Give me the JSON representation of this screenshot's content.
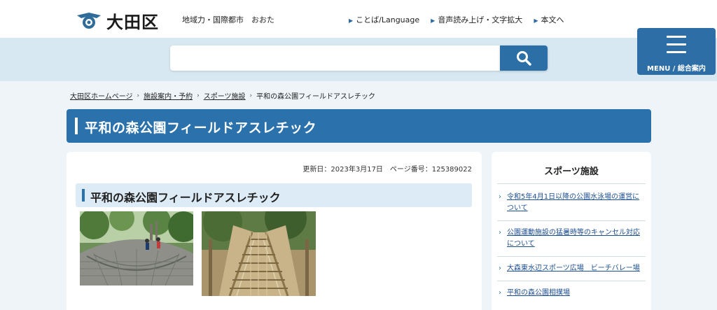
{
  "header": {
    "logo_text": "大田区",
    "tagline": "地域力・国際都市　おおた",
    "links": [
      "ことば/Language",
      "音声読み上げ・文字拡大",
      "本文へ"
    ]
  },
  "search": {
    "placeholder": "",
    "button_icon": "search-icon"
  },
  "menu": {
    "label": "MENU / 総合案内",
    "icon": "hamburger-icon"
  },
  "breadcrumb": [
    "大田区ホームページ",
    "施設案内・予約",
    "スポーツ施設",
    "平和の森公園フィールドアスレチック"
  ],
  "page": {
    "title": "平和の森公園フィールドアスレチック",
    "updated": "更新日：2023年3月17日　ページ番号：125389022",
    "subheading": "平和の森公園フィールドアスレチック"
  },
  "sidebar": {
    "title": "スポーツ施設",
    "items": [
      "令和5年4月1日以降の公園水泳場の運営について",
      "公園運動施設の猛暑時等のキャンセル対応について",
      "大森東水辺スポーツ広場　ビーチバレー場",
      "平和の森公園相撲場"
    ]
  },
  "colors": {
    "brand_blue": "#2b72ad",
    "light_blue": "#d7e8f3",
    "link": "#1d4f91"
  }
}
